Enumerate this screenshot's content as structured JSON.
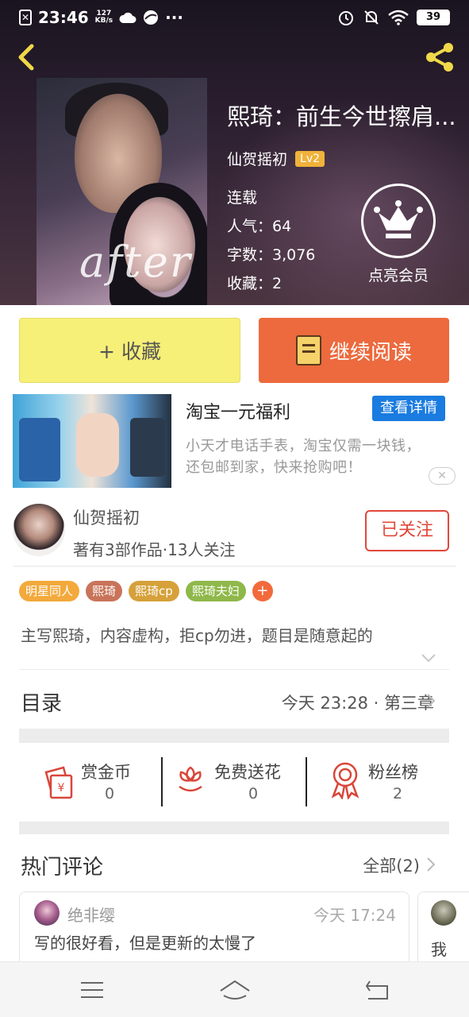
{
  "status_bar": {
    "time": "23:46",
    "speed_top": "127",
    "speed_unit": "KB/s",
    "dots": "···",
    "battery": "39"
  },
  "book": {
    "title": "熙琦：前生今世擦肩...",
    "author": "仙贺摇初",
    "level": "Lv2",
    "status": "连载",
    "popularity": "人气：64",
    "word_count": "字数：3,076",
    "favorites": "收藏：2",
    "vip_label": "点亮会员",
    "cover_script": "after"
  },
  "actions": {
    "favorite_label": "+ 收藏",
    "continue_label": "继续阅读"
  },
  "ad": {
    "title": "淘宝一元福利",
    "cta": "查看详情",
    "description": "小天才电话手表，淘宝仅需一块钱，还包邮到家，快来抢购吧！",
    "close_symbol": "✕"
  },
  "author": {
    "name": "仙贺摇初",
    "stats": "著有3部作品·13人关注",
    "follow_label": "已关注"
  },
  "tags": [
    {
      "label": "明星同人",
      "color": "#f3a93b"
    },
    {
      "label": "熙琦",
      "color": "#c9745a"
    },
    {
      "label": "熙琦cp",
      "color": "#d6a13a"
    },
    {
      "label": "熙琦夫妇",
      "color": "#8fb84a"
    }
  ],
  "tag_add_symbol": "+",
  "description": "主写熙琦，内容虚构，拒cp勿进，题目是随意起的",
  "catalog": {
    "title": "目录",
    "latest": "今天 23:28 · 第三章"
  },
  "stats": [
    {
      "label": "赏金币",
      "value": "0",
      "icon": "reward-coin-icon"
    },
    {
      "label": "免费送花",
      "value": "0",
      "icon": "flower-icon"
    },
    {
      "label": "粉丝榜",
      "value": "2",
      "icon": "ribbon-medal-icon"
    }
  ],
  "hot_comments": {
    "title": "热门评论",
    "all_label": "全部(2)",
    "items": [
      {
        "user": "绝非缨",
        "time": "今天 17:24",
        "text": "写的很好看，但是更新的太慢了"
      },
      {
        "user": "",
        "time": "",
        "text": "我"
      }
    ]
  },
  "colors": {
    "accent_orange": "#ec6a3d",
    "favorite_yellow": "#f6ef78",
    "follow_red": "#e0483b",
    "link_blue": "#1a7be0",
    "icon_red": "#d9463a"
  }
}
